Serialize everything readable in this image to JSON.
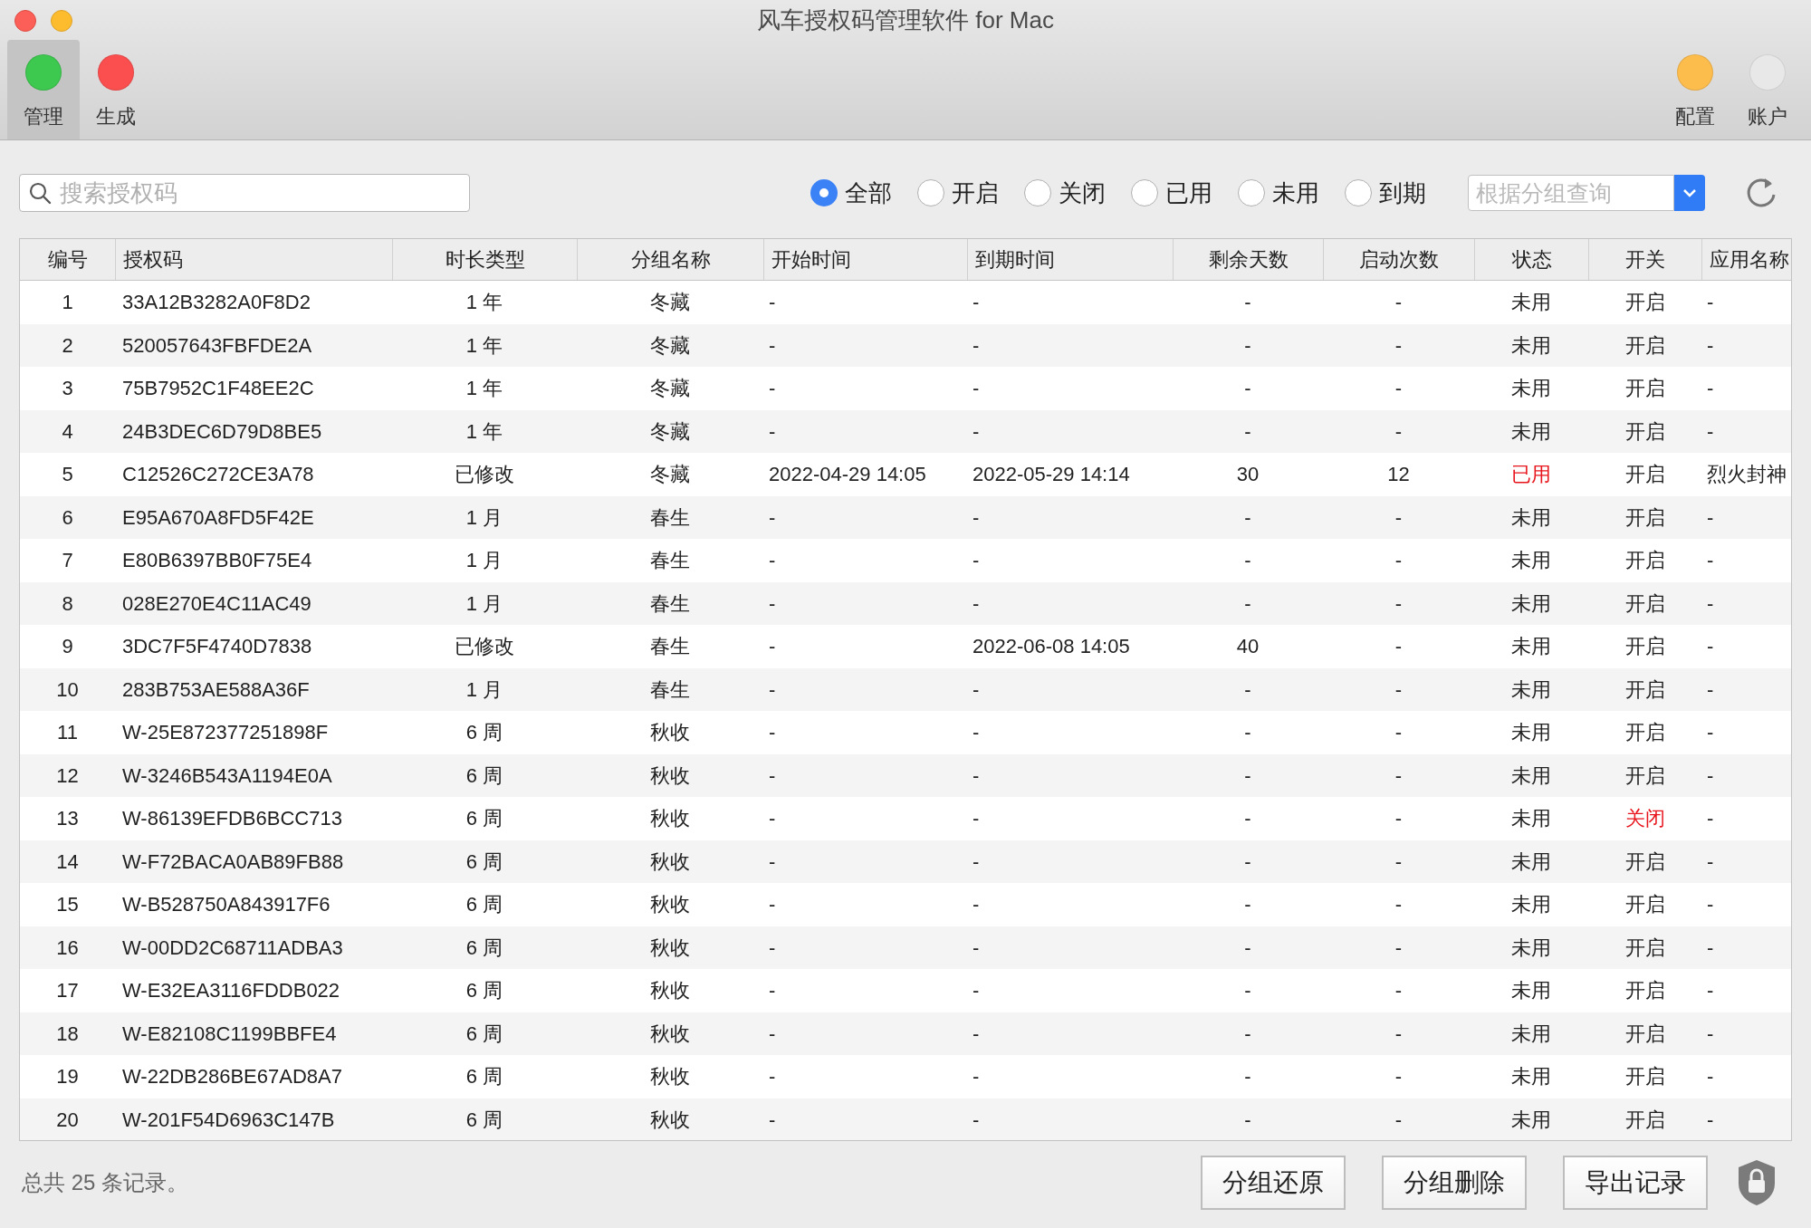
{
  "window": {
    "title": "风车授权码管理软件 for Mac"
  },
  "toolbar": {
    "left": [
      {
        "label": "管理",
        "selected": true,
        "color": "#3dc84f"
      },
      {
        "label": "生成",
        "selected": false,
        "color": "#fb4f4f"
      }
    ],
    "right": [
      {
        "label": "配置",
        "selected": false,
        "color": "#fdbd4d"
      },
      {
        "label": "账户",
        "selected": false,
        "color": "#e8e8e8"
      }
    ]
  },
  "search": {
    "placeholder": "搜索授权码"
  },
  "filters": [
    {
      "label": "全部",
      "selected": true
    },
    {
      "label": "开启",
      "selected": false
    },
    {
      "label": "关闭",
      "selected": false
    },
    {
      "label": "已用",
      "selected": false
    },
    {
      "label": "未用",
      "selected": false
    },
    {
      "label": "到期",
      "selected": false
    }
  ],
  "group_query": {
    "placeholder": "根据分组查询"
  },
  "table": {
    "columns": [
      "编号",
      "授权码",
      "时长类型",
      "分组名称",
      "开始时间",
      "到期时间",
      "剩余天数",
      "启动次数",
      "状态",
      "开关",
      "应用名称"
    ],
    "rows": [
      {
        "no": "1",
        "code": "33A12B3282A0F8D2",
        "duration": "1 年",
        "group": "冬藏",
        "start": "-",
        "end": "-",
        "days": "-",
        "launches": "-",
        "status": "未用",
        "used": false,
        "switch": "开启",
        "on": true,
        "app": "-"
      },
      {
        "no": "2",
        "code": "520057643FBFDE2A",
        "duration": "1 年",
        "group": "冬藏",
        "start": "-",
        "end": "-",
        "days": "-",
        "launches": "-",
        "status": "未用",
        "used": false,
        "switch": "开启",
        "on": true,
        "app": "-"
      },
      {
        "no": "3",
        "code": "75B7952C1F48EE2C",
        "duration": "1 年",
        "group": "冬藏",
        "start": "-",
        "end": "-",
        "days": "-",
        "launches": "-",
        "status": "未用",
        "used": false,
        "switch": "开启",
        "on": true,
        "app": "-"
      },
      {
        "no": "4",
        "code": "24B3DEC6D79D8BE5",
        "duration": "1 年",
        "group": "冬藏",
        "start": "-",
        "end": "-",
        "days": "-",
        "launches": "-",
        "status": "未用",
        "used": false,
        "switch": "开启",
        "on": true,
        "app": "-"
      },
      {
        "no": "5",
        "code": "C12526C272CE3A78",
        "duration": "已修改",
        "group": "冬藏",
        "start": "2022-04-29 14:05",
        "end": "2022-05-29 14:14",
        "days": "30",
        "launches": "12",
        "status": "已用",
        "used": true,
        "switch": "开启",
        "on": true,
        "app": "烈火封神"
      },
      {
        "no": "6",
        "code": "E95A670A8FD5F42E",
        "duration": "1 月",
        "group": "春生",
        "start": "-",
        "end": "-",
        "days": "-",
        "launches": "-",
        "status": "未用",
        "used": false,
        "switch": "开启",
        "on": true,
        "app": "-"
      },
      {
        "no": "7",
        "code": "E80B6397BB0F75E4",
        "duration": "1 月",
        "group": "春生",
        "start": "-",
        "end": "-",
        "days": "-",
        "launches": "-",
        "status": "未用",
        "used": false,
        "switch": "开启",
        "on": true,
        "app": "-"
      },
      {
        "no": "8",
        "code": "028E270E4C11AC49",
        "duration": "1 月",
        "group": "春生",
        "start": "-",
        "end": "-",
        "days": "-",
        "launches": "-",
        "status": "未用",
        "used": false,
        "switch": "开启",
        "on": true,
        "app": "-"
      },
      {
        "no": "9",
        "code": "3DC7F5F4740D7838",
        "duration": "已修改",
        "group": "春生",
        "start": "-",
        "end": "2022-06-08 14:05",
        "days": "40",
        "launches": "-",
        "status": "未用",
        "used": false,
        "switch": "开启",
        "on": true,
        "app": "-"
      },
      {
        "no": "10",
        "code": "283B753AE588A36F",
        "duration": "1 月",
        "group": "春生",
        "start": "-",
        "end": "-",
        "days": "-",
        "launches": "-",
        "status": "未用",
        "used": false,
        "switch": "开启",
        "on": true,
        "app": "-"
      },
      {
        "no": "11",
        "code": "W-25E872377251898F",
        "duration": "6 周",
        "group": "秋收",
        "start": "-",
        "end": "-",
        "days": "-",
        "launches": "-",
        "status": "未用",
        "used": false,
        "switch": "开启",
        "on": true,
        "app": "-"
      },
      {
        "no": "12",
        "code": "W-3246B543A1194E0A",
        "duration": "6 周",
        "group": "秋收",
        "start": "-",
        "end": "-",
        "days": "-",
        "launches": "-",
        "status": "未用",
        "used": false,
        "switch": "开启",
        "on": true,
        "app": "-"
      },
      {
        "no": "13",
        "code": "W-86139EFDB6BCC713",
        "duration": "6 周",
        "group": "秋收",
        "start": "-",
        "end": "-",
        "days": "-",
        "launches": "-",
        "status": "未用",
        "used": false,
        "switch": "关闭",
        "on": false,
        "app": "-"
      },
      {
        "no": "14",
        "code": "W-F72BACA0AB89FB88",
        "duration": "6 周",
        "group": "秋收",
        "start": "-",
        "end": "-",
        "days": "-",
        "launches": "-",
        "status": "未用",
        "used": false,
        "switch": "开启",
        "on": true,
        "app": "-"
      },
      {
        "no": "15",
        "code": "W-B528750A843917F6",
        "duration": "6 周",
        "group": "秋收",
        "start": "-",
        "end": "-",
        "days": "-",
        "launches": "-",
        "status": "未用",
        "used": false,
        "switch": "开启",
        "on": true,
        "app": "-"
      },
      {
        "no": "16",
        "code": "W-00DD2C68711ADBA3",
        "duration": "6 周",
        "group": "秋收",
        "start": "-",
        "end": "-",
        "days": "-",
        "launches": "-",
        "status": "未用",
        "used": false,
        "switch": "开启",
        "on": true,
        "app": "-"
      },
      {
        "no": "17",
        "code": "W-E32EA3116FDDB022",
        "duration": "6 周",
        "group": "秋收",
        "start": "-",
        "end": "-",
        "days": "-",
        "launches": "-",
        "status": "未用",
        "used": false,
        "switch": "开启",
        "on": true,
        "app": "-"
      },
      {
        "no": "18",
        "code": "W-E82108C1199BBFE4",
        "duration": "6 周",
        "group": "秋收",
        "start": "-",
        "end": "-",
        "days": "-",
        "launches": "-",
        "status": "未用",
        "used": false,
        "switch": "开启",
        "on": true,
        "app": "-"
      },
      {
        "no": "19",
        "code": "W-22DB286BE67AD8A7",
        "duration": "6 周",
        "group": "秋收",
        "start": "-",
        "end": "-",
        "days": "-",
        "launches": "-",
        "status": "未用",
        "used": false,
        "switch": "开启",
        "on": true,
        "app": "-"
      },
      {
        "no": "20",
        "code": "W-201F54D6963C147B",
        "duration": "6 周",
        "group": "秋收",
        "start": "-",
        "end": "-",
        "days": "-",
        "launches": "-",
        "status": "未用",
        "used": false,
        "switch": "开启",
        "on": true,
        "app": "-"
      }
    ]
  },
  "status_text": "总共 25 条记录。",
  "buttons": [
    "分组还原",
    "分组删除",
    "导出记录"
  ]
}
